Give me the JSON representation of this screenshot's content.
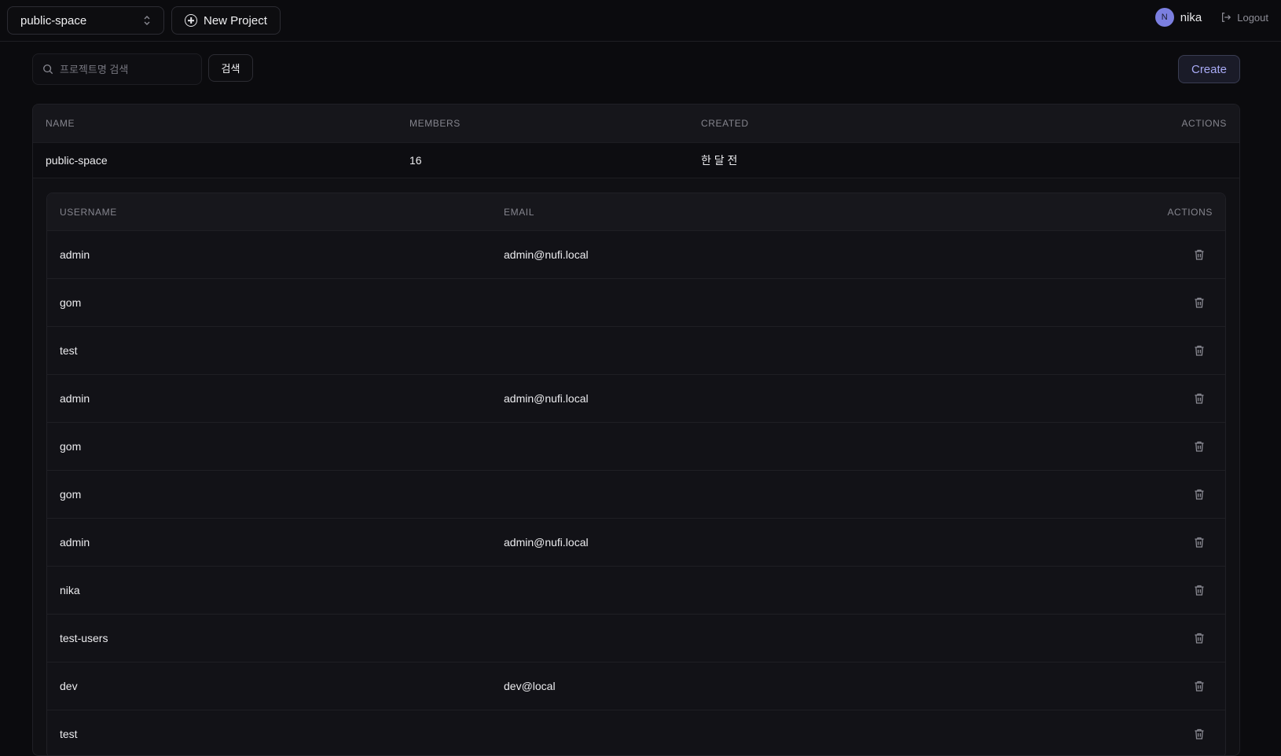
{
  "topbar": {
    "project_name": "public-space",
    "new_project_label": "New Project",
    "user_initial": "N",
    "username": "nika",
    "logout_label": "Logout"
  },
  "toolbar": {
    "search_placeholder": "프로젝트명 검색",
    "search_value": "",
    "search_button": "검색",
    "create_button": "Create"
  },
  "projects_table": {
    "headers": {
      "name": "NAME",
      "members": "MEMBERS",
      "created": "CREATED",
      "actions": "ACTIONS"
    },
    "rows": [
      {
        "name": "public-space",
        "members": "16",
        "created": "한 달 전"
      }
    ]
  },
  "members_table": {
    "headers": {
      "username": "USERNAME",
      "email": "EMAIL",
      "actions": "ACTIONS"
    },
    "rows": [
      {
        "username": "admin",
        "email": "admin@nufi.local"
      },
      {
        "username": "gom",
        "email": ""
      },
      {
        "username": "test",
        "email": ""
      },
      {
        "username": "admin",
        "email": "admin@nufi.local"
      },
      {
        "username": "gom",
        "email": ""
      },
      {
        "username": "gom",
        "email": ""
      },
      {
        "username": "admin",
        "email": "admin@nufi.local"
      },
      {
        "username": "nika",
        "email": ""
      },
      {
        "username": "test-users",
        "email": ""
      },
      {
        "username": "dev",
        "email": "dev@local"
      },
      {
        "username": "test",
        "email": ""
      }
    ]
  },
  "colors": {
    "background": "#0b0b0e",
    "accent": "#a8aaf5",
    "avatar": "#7b7fe0"
  }
}
